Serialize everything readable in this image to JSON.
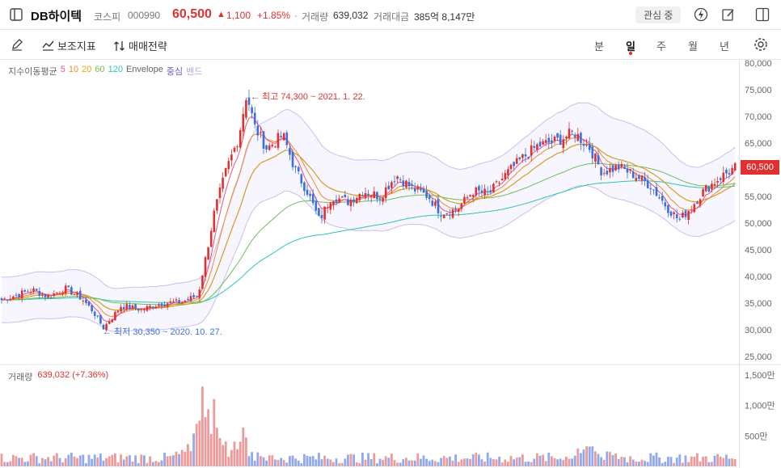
{
  "header": {
    "name": "DB하이텍",
    "market": "코스피",
    "code": "000990",
    "price": "60,500",
    "change_arrow": "▲",
    "change": "1,100",
    "change_pct": "+1.85%",
    "volume_label": "거래량",
    "volume": "639,032",
    "amount_label": "거래대금",
    "amount": "385억 8,147만",
    "watch_label": "관심 중"
  },
  "toolbar": {
    "indicator_label": "보조지표",
    "strategy_label": "매매전략",
    "periods": [
      "분",
      "일",
      "주",
      "월",
      "년"
    ],
    "active_period": "일"
  },
  "legend": {
    "label": "지수이동평균",
    "ma": [
      {
        "label": "5",
        "color": "#e8508a"
      },
      {
        "label": "10",
        "color": "#f08a2e"
      },
      {
        "label": "20",
        "color": "#e6a700"
      },
      {
        "label": "60",
        "color": "#6bbf59"
      },
      {
        "label": "120",
        "color": "#2ec4b6"
      }
    ],
    "envelope": "Envelope",
    "env_mid": "중심",
    "env_band": "밴드"
  },
  "annotations": {
    "high": "← 최고 74,300 ~ 2021. 1. 22.",
    "low": "← 최저 30,350 ~ 2020. 10. 27."
  },
  "volume_legend": {
    "label": "거래량",
    "value": "639,032 (+7.36%)"
  },
  "colors": {
    "up": "#e03131",
    "down": "#3b6fd9",
    "vol_up": "#ef9a9a",
    "vol_down": "#90a9ef",
    "accent": "#e03131"
  },
  "chart_data": {
    "type": "candlestick",
    "y_axis": {
      "min": 25000,
      "max": 80000,
      "ticks": [
        "80,000",
        "75,000",
        "70,000",
        "65,000",
        "60,000",
        "55,000",
        "50,000",
        "45,000",
        "40,000",
        "35,000",
        "30,000",
        "25,000"
      ]
    },
    "volume_axis": {
      "ticks": [
        "1,500만",
        "1,000만",
        "500만"
      ]
    },
    "current_price_label": "60,500",
    "close_path": [
      [
        0,
        35500
      ],
      [
        20,
        36500
      ],
      [
        40,
        37500
      ],
      [
        60,
        36200
      ],
      [
        80,
        37800
      ],
      [
        100,
        36000
      ],
      [
        115,
        33500
      ],
      [
        128,
        30350
      ],
      [
        150,
        34500
      ],
      [
        175,
        33800
      ],
      [
        200,
        35000
      ],
      [
        225,
        35200
      ],
      [
        245,
        36500
      ],
      [
        255,
        44000
      ],
      [
        265,
        52000
      ],
      [
        280,
        60000
      ],
      [
        295,
        66000
      ],
      [
        305,
        74300
      ],
      [
        315,
        68000
      ],
      [
        330,
        64000
      ],
      [
        350,
        66500
      ],
      [
        365,
        60000
      ],
      [
        380,
        56000
      ],
      [
        395,
        50500
      ],
      [
        410,
        55000
      ],
      [
        430,
        54000
      ],
      [
        450,
        56000
      ],
      [
        470,
        55000
      ],
      [
        490,
        59000
      ],
      [
        510,
        56500
      ],
      [
        530,
        55000
      ],
      [
        545,
        52000
      ],
      [
        565,
        52500
      ],
      [
        585,
        56000
      ],
      [
        605,
        55500
      ],
      [
        625,
        59000
      ],
      [
        645,
        62000
      ],
      [
        665,
        64500
      ],
      [
        690,
        65500
      ],
      [
        710,
        67000
      ],
      [
        730,
        64000
      ],
      [
        745,
        59500
      ],
      [
        765,
        60500
      ],
      [
        785,
        59000
      ],
      [
        805,
        57000
      ],
      [
        825,
        53000
      ],
      [
        840,
        50500
      ],
      [
        855,
        53000
      ],
      [
        870,
        56000
      ],
      [
        890,
        58500
      ],
      [
        910,
        60500
      ]
    ],
    "volume_peaks": [
      [
        250,
        12500000
      ],
      [
        265,
        8000000
      ],
      [
        300,
        3500000
      ],
      [
        730,
        3000000
      ]
    ]
  }
}
